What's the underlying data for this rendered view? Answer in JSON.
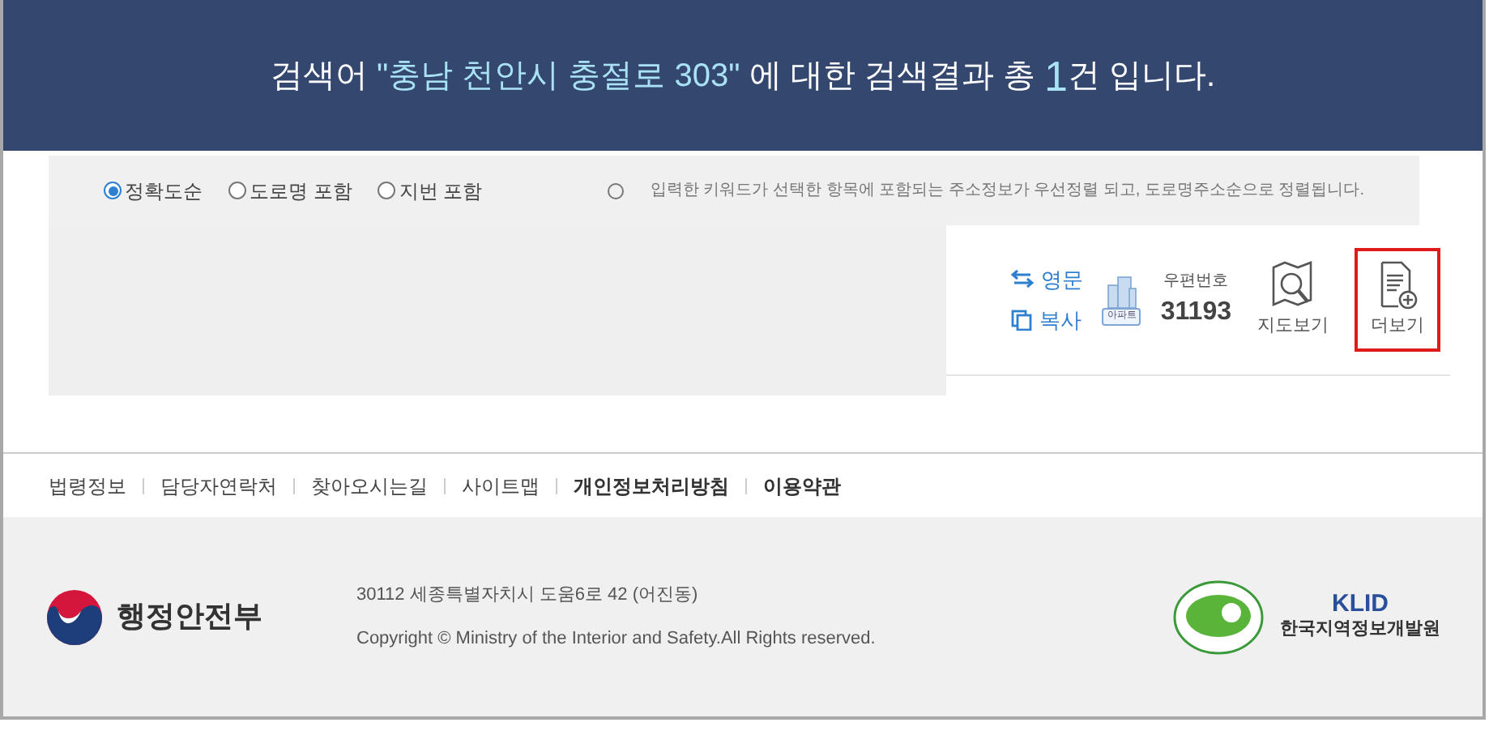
{
  "banner": {
    "before": "검색어 ",
    "keyword": "\"충남 천안시 충절로 303\"",
    "middle": " 에 대한 검색결과 총 ",
    "count": "1",
    "after": "건 입니다."
  },
  "sort_options": [
    {
      "label": "정확도순",
      "selected": true
    },
    {
      "label": "도로명 포함",
      "selected": false
    },
    {
      "label": "지번 포함",
      "selected": false
    }
  ],
  "sort_note": "입력한 키워드가 선택한 항목에 포함되는 주소정보가 우선정렬 되고, 도로명주소순으로 정렬됩니다.",
  "result": {
    "links": [
      {
        "kind": "swap",
        "label": "영문"
      },
      {
        "kind": "copy",
        "label": "복사"
      }
    ],
    "building_badge": "아파트",
    "postcode_label": "우편번호",
    "postcode": "31193",
    "actions": [
      {
        "kind": "map",
        "label": "지도보기",
        "highlighted": false
      },
      {
        "kind": "more",
        "label": "더보기",
        "highlighted": true
      }
    ]
  },
  "footer_links": [
    {
      "label": "법령정보",
      "bold": false
    },
    {
      "label": "담당자연락처",
      "bold": false
    },
    {
      "label": "찾아오시는길",
      "bold": false
    },
    {
      "label": "사이트맵",
      "bold": false
    },
    {
      "label": "개인정보처리방침",
      "bold": true
    },
    {
      "label": "이용약관",
      "bold": true
    }
  ],
  "footer": {
    "ministry": "행정안전부",
    "address": "30112 세종특별자치시 도움6로 42 (어진동)",
    "copyright": "Copyright © Ministry of the Interior and Safety.All Rights reserved.",
    "klid": "KLID",
    "klid_name": "한국지역정보개발원"
  }
}
